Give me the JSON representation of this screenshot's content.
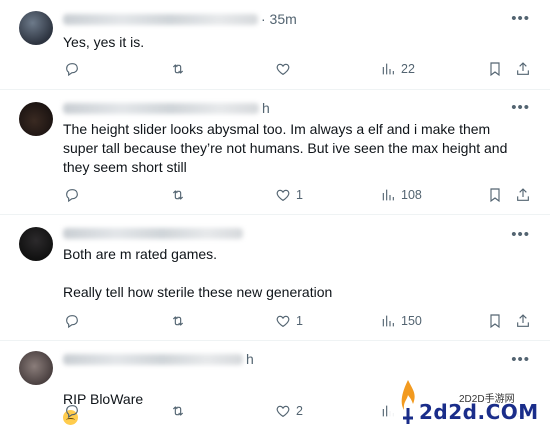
{
  "posts": [
    {
      "time": "· 35m",
      "text": "Yes, yes it is.",
      "replies": "",
      "reposts": "",
      "likes": "",
      "views": "22"
    },
    {
      "time": "h",
      "text": "The height slider looks abysmal too. Im always a elf and i make them super tall because they’re not humans. But ive seen the max height and they seem short still",
      "replies": "",
      "reposts": "",
      "likes": "1",
      "views": "108"
    },
    {
      "time": "",
      "text": "Both are m rated games.\n\nReally tell how sterile these new generation",
      "replies": "",
      "reposts": "",
      "likes": "1",
      "views": "150"
    },
    {
      "time": "h",
      "text": "RIP BloWare",
      "replies": "",
      "reposts": "",
      "likes": "2",
      "views": ""
    }
  ],
  "icons": {
    "reply": "reply-icon",
    "repost": "repost-icon",
    "like": "heart-icon",
    "views": "analytics-icon",
    "bookmark": "bookmark-icon",
    "share": "share-icon",
    "more": "more-icon",
    "emoji": "relieved-face-emoji"
  },
  "watermark": {
    "site": "2D2D手游网",
    "logo": "2d2d.COM"
  },
  "colors": {
    "text": "#0f1419",
    "secondary": "#536471",
    "divider": "#eff3f4"
  }
}
